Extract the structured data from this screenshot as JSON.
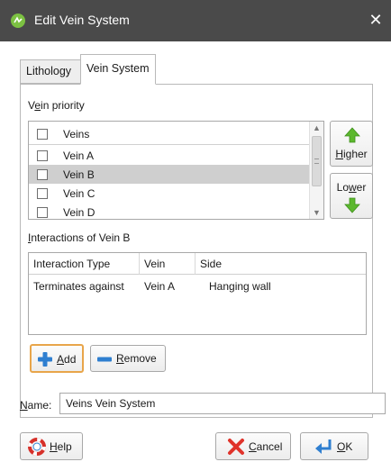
{
  "window": {
    "title": "Edit Vein System",
    "close_glyph": "✕"
  },
  "tabs": [
    {
      "label": "Lithology",
      "active": false
    },
    {
      "label": "Vein System",
      "active": true
    }
  ],
  "vein_priority": {
    "label_pre": "V",
    "label_underlined": "e",
    "label_post": "in priority",
    "header": "Veins",
    "items": [
      {
        "label": "Vein A",
        "checked": false,
        "selected": false
      },
      {
        "label": "Vein B",
        "checked": false,
        "selected": true
      },
      {
        "label": "Vein C",
        "checked": false,
        "selected": false
      },
      {
        "label": "Vein D",
        "checked": false,
        "selected": false
      }
    ],
    "higher_pre": "",
    "higher_underlined": "H",
    "higher_post": "igher",
    "lower_pre": "Lo",
    "lower_underlined": "w",
    "lower_post": "er"
  },
  "interactions": {
    "label_pre": "",
    "label_underlined": "I",
    "label_post": "nteractions of Vein B",
    "columns": [
      "Interaction Type",
      "Vein",
      "Side"
    ],
    "rows": [
      {
        "type": "Terminates against",
        "vein": "Vein A",
        "side": "Hanging wall"
      }
    ],
    "add_underlined": "A",
    "add_post": "dd",
    "remove_underlined": "R",
    "remove_post": "emove"
  },
  "name_field": {
    "label_underlined": "N",
    "label_post": "ame:",
    "value": "Veins Vein System"
  },
  "footer": {
    "help_underlined": "H",
    "help_post": "elp",
    "cancel_underlined": "C",
    "cancel_post": "ancel",
    "ok_underlined": "O",
    "ok_post": "K"
  },
  "colors": {
    "titlebar": "#4a4a4a",
    "logo_green": "#7cc142",
    "arrow_green": "#5cb82e",
    "focus_orange": "#e8a54a",
    "add_blue": "#2f7fd0",
    "cancel_red": "#e0332b"
  },
  "icons": {
    "logo": "leapfrog-logo-icon",
    "higher": "arrow-up-icon",
    "lower": "arrow-down-icon",
    "add": "plus-icon",
    "remove": "minus-icon",
    "help": "help-icon",
    "cancel": "cancel-x-icon",
    "ok": "enter-arrow-icon"
  }
}
